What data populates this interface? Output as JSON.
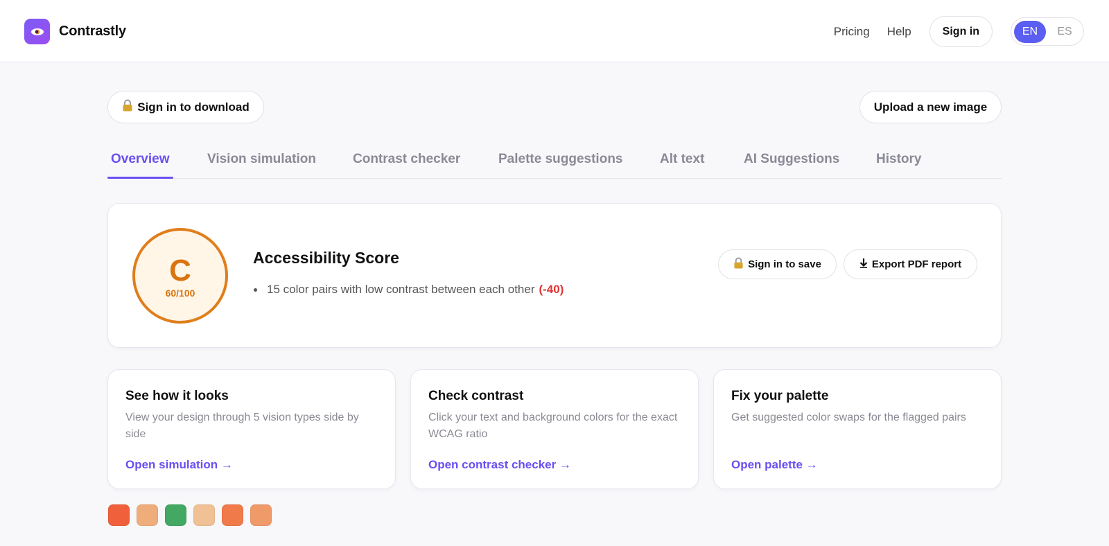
{
  "app": {
    "name": "Contrastly"
  },
  "nav": {
    "pricing": "Pricing",
    "help": "Help",
    "sign_in": "Sign in",
    "languages": [
      {
        "label": "EN",
        "active": true
      },
      {
        "label": "ES",
        "active": false
      }
    ]
  },
  "actions": {
    "download": "Sign in to download",
    "download_icon": "lock-icon",
    "upload": "Upload a new image"
  },
  "tabs": [
    {
      "label": "Overview",
      "active": true
    },
    {
      "label": "Vision simulation",
      "active": false
    },
    {
      "label": "Contrast checker",
      "active": false
    },
    {
      "label": "Palette suggestions",
      "active": false
    },
    {
      "label": "Alt text",
      "active": false
    },
    {
      "label": "AI Suggestions",
      "active": false
    },
    {
      "label": "History",
      "active": false
    }
  ],
  "score": {
    "grade": "C",
    "points": "60/100",
    "title": "Accessibility Score",
    "issues": [
      {
        "text": "15 color pairs with low contrast between each other",
        "penalty": "(-40)"
      }
    ],
    "save_label": "Sign in to save",
    "save_icon": "lock-icon",
    "export_label": "Export PDF report",
    "export_icon": "download-arrow-icon"
  },
  "features": [
    {
      "title": "See how it looks",
      "description": "View your design through 5 vision types side by side",
      "link": "Open simulation →"
    },
    {
      "title": "Check contrast",
      "description": "Click your text and background colors for the exact WCAG ratio",
      "link": "Open contrast checker →"
    },
    {
      "title": "Fix your palette",
      "description": "Get suggested color swaps for the flagged pairs",
      "link": "Open palette →"
    }
  ],
  "palette": [
    "#f0603a",
    "#f0ad7c",
    "#43a862",
    "#f0c195",
    "#f07a4a",
    "#f09a6a"
  ],
  "colors": {
    "accent": "#6b4ef0",
    "grade": "#d9740f",
    "penalty": "#e03535"
  }
}
